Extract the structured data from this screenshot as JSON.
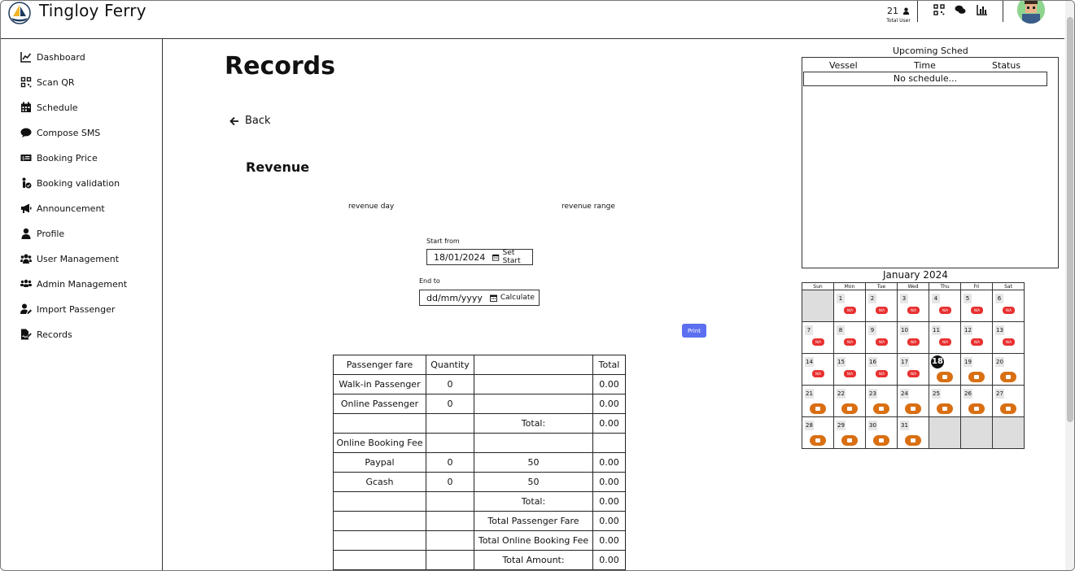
{
  "app": {
    "name": "Tingloy Ferry"
  },
  "header": {
    "user_count": "21",
    "user_count_label": "Total User"
  },
  "sidebar": {
    "items": [
      {
        "label": "Dashboard"
      },
      {
        "label": "Scan QR"
      },
      {
        "label": "Schedule"
      },
      {
        "label": "Compose SMS"
      },
      {
        "label": "Booking Price"
      },
      {
        "label": "Booking validation"
      },
      {
        "label": "Announcement"
      },
      {
        "label": "Profile"
      },
      {
        "label": "User Management"
      },
      {
        "label": "Admin Management"
      },
      {
        "label": "Import Passenger"
      },
      {
        "label": "Records"
      }
    ]
  },
  "main": {
    "title": "Records",
    "back_label": "Back",
    "section_title": "Revenue",
    "tab_day": "revenue day",
    "tab_range": "revenue range",
    "start_label": "Start from",
    "start_value": "18/01/2024",
    "start_button": "Set Start",
    "end_label": "End to",
    "end_value": "dd/mm/yyyy",
    "end_button": "Calculate",
    "print_label": "Print"
  },
  "table": {
    "rows": [
      [
        "Passenger fare",
        "Quantity",
        "",
        "Total"
      ],
      [
        "Walk-in Passenger",
        "0",
        "",
        "0.00"
      ],
      [
        "Online Passenger",
        "0",
        "",
        "0.00"
      ],
      [
        "",
        "",
        "Total:",
        "0.00"
      ],
      [
        "Online Booking Fee",
        "",
        "",
        ""
      ],
      [
        "Paypal",
        "0",
        "50",
        "0.00"
      ],
      [
        "Gcash",
        "0",
        "50",
        "0.00"
      ],
      [
        "",
        "",
        "Total:",
        "0.00"
      ],
      [
        "",
        "",
        "Total Passenger Fare",
        "0.00"
      ],
      [
        "",
        "",
        "Total Online Booking Fee",
        "0.00"
      ],
      [
        "",
        "",
        "Total Amount:",
        "0.00"
      ]
    ]
  },
  "schedule": {
    "title": "Upcoming Sched",
    "col_vessel": "Vessel",
    "col_time": "Time",
    "col_status": "Status",
    "empty_text": "No schedule..."
  },
  "calendar": {
    "title": "January 2024",
    "weekdays": [
      "Sun",
      "Mon",
      "Tue",
      "Wed",
      "Thu",
      "Fri",
      "Sat"
    ],
    "leading_blanks": 1,
    "days_in_month": 31,
    "today": 18,
    "na_label": "N/A"
  },
  "colors": {
    "accent": "#5b6ff0",
    "na": "#e83030",
    "booking": "#d96f12"
  }
}
